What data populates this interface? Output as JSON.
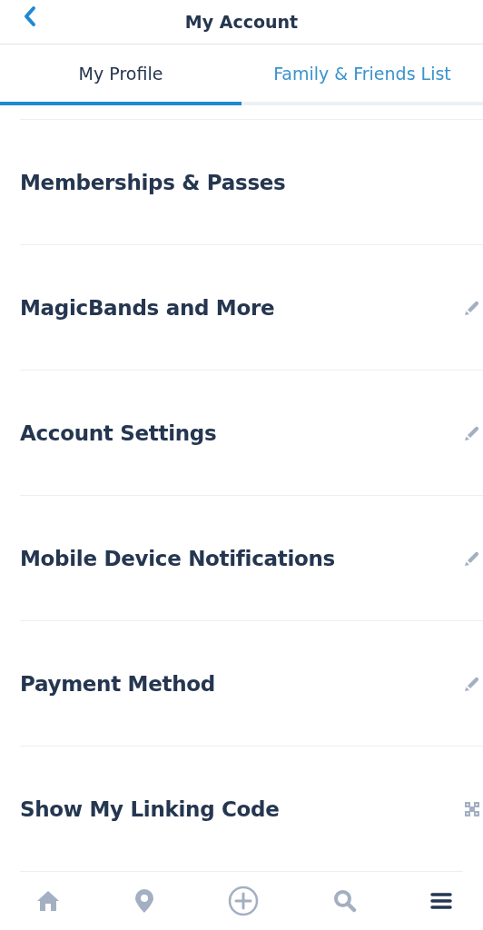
{
  "header": {
    "title": "My Account"
  },
  "tabs": [
    {
      "label": "My Profile",
      "selected": true
    },
    {
      "label": "Family & Friends List",
      "selected": false
    }
  ],
  "items": [
    {
      "label": "Memberships & Passes",
      "kind": "plain"
    },
    {
      "label": "MagicBands and More",
      "kind": "edit"
    },
    {
      "label": "Account Settings",
      "kind": "edit"
    },
    {
      "label": "Mobile Device Notifications",
      "kind": "edit"
    },
    {
      "label": "Payment Method",
      "kind": "edit"
    },
    {
      "label": "Show My Linking Code",
      "kind": "code"
    }
  ],
  "nav": [
    {
      "kind": "home",
      "selected": false
    },
    {
      "kind": "location",
      "selected": false
    },
    {
      "kind": "add",
      "selected": false
    },
    {
      "kind": "search",
      "selected": false
    },
    {
      "kind": "menu",
      "selected": true
    }
  ]
}
